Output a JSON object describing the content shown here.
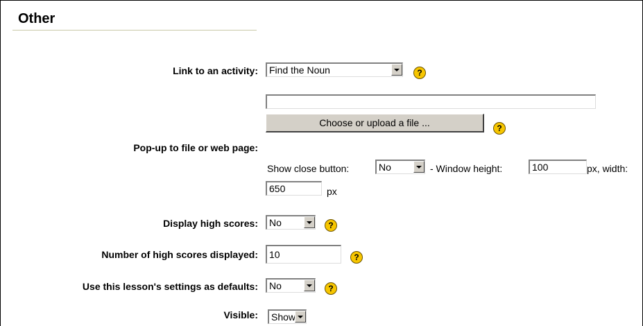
{
  "section": {
    "title": "Other"
  },
  "fields": {
    "link_activity": {
      "label": "Link to an activity:",
      "value": "Find the Noun"
    },
    "popup": {
      "label": "Pop-up to file or web page:",
      "url_value": "",
      "choose_button": "Choose or upload a file ...",
      "show_close_label": "Show close button:",
      "show_close_value": "No",
      "window_height_label": "- Window height:",
      "window_height_value": "100",
      "px_width_label": "px, width:",
      "width_value": "650",
      "px_label": "px"
    },
    "display_high_scores": {
      "label": "Display high scores:",
      "value": "No"
    },
    "num_high_scores": {
      "label": "Number of high scores displayed:",
      "value": "10"
    },
    "use_as_defaults": {
      "label": "Use this lesson's settings as defaults:",
      "value": "No"
    },
    "visible": {
      "label": "Visible:",
      "value": "Show"
    }
  },
  "help_icon_glyph": "?",
  "colors": {
    "help_icon": "#f7c600",
    "section_rule": "#c9c9a8",
    "button_face": "#d4d0c8"
  }
}
